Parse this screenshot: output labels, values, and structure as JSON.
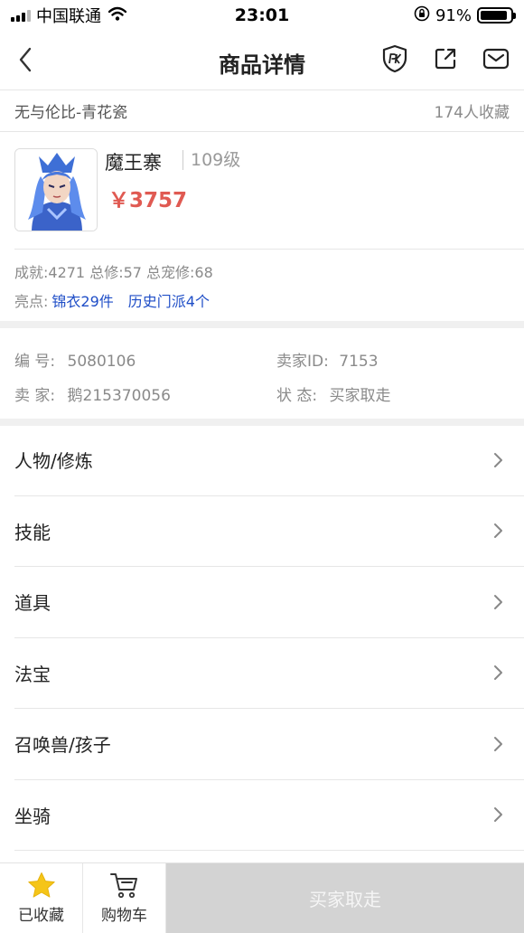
{
  "status_bar": {
    "carrier": "中国联通",
    "time": "23:01",
    "battery_text": "91%",
    "battery_level": 0.91
  },
  "nav": {
    "title": "商品详情",
    "back_icon": "chevron-left-icon",
    "icons": [
      "pk-shield-icon",
      "share-icon",
      "mail-icon"
    ]
  },
  "item": {
    "server": "无与伦比-青花瓷",
    "favorites": "174人收藏",
    "name": "魔王寨",
    "level": "109级",
    "price": "￥3757",
    "stats": "成就:4271 总修:57 总宠修:68",
    "highlights_label": "亮点:",
    "highlights": [
      "锦衣29件",
      "历史门派4个"
    ]
  },
  "meta": {
    "id_label": "编 号:",
    "id_value": "5080106",
    "seller_id_label": "卖家ID:",
    "seller_id_value": "7153",
    "seller_label": "卖 家:",
    "seller_value": "鹅215370056",
    "status_label": "状 态:",
    "status_value": "买家取走"
  },
  "menu": [
    {
      "label": "人物/修炼"
    },
    {
      "label": "技能"
    },
    {
      "label": "道具"
    },
    {
      "label": "法宝"
    },
    {
      "label": "召唤兽/孩子"
    },
    {
      "label": "坐骑"
    }
  ],
  "bottom": {
    "favorite_label": "已收藏",
    "cart_label": "购物车",
    "buy_label": "买家取走"
  },
  "colors": {
    "price": "#e05a52",
    "highlight_link": "#1f4ec7",
    "star": "#f5c518",
    "buy_disabled_bg": "#d3d3d3"
  }
}
